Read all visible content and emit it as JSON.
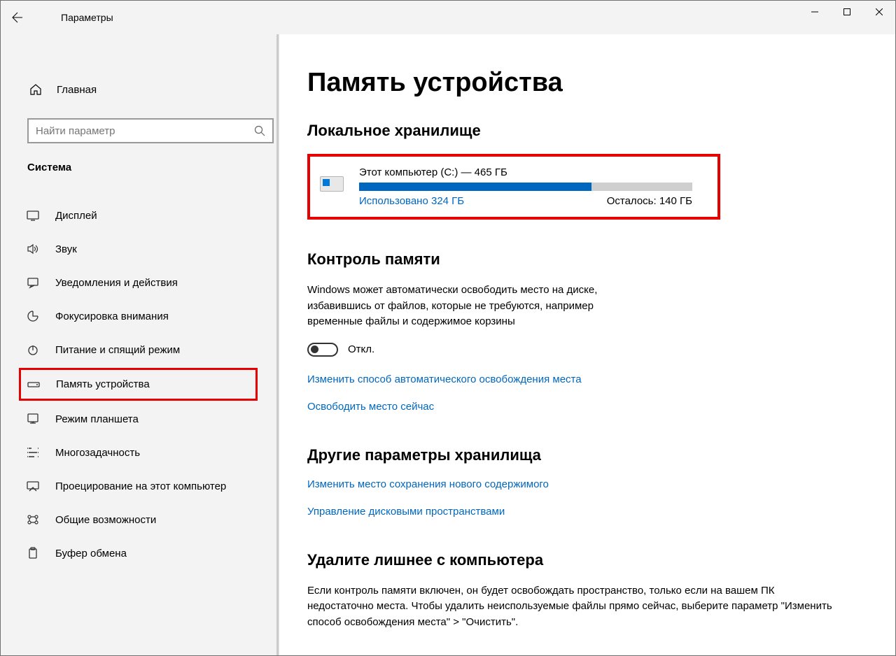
{
  "titlebar": {
    "title": "Параметры"
  },
  "sidebar": {
    "home": "Главная",
    "search_placeholder": "Найти параметр",
    "category": "Система",
    "items": [
      {
        "id": "display",
        "label": "Дисплей"
      },
      {
        "id": "sound",
        "label": "Звук"
      },
      {
        "id": "notifications",
        "label": "Уведомления и действия"
      },
      {
        "id": "focus",
        "label": "Фокусировка внимания"
      },
      {
        "id": "power",
        "label": "Питание и спящий режим"
      },
      {
        "id": "storage",
        "label": "Память устройства"
      },
      {
        "id": "tablet",
        "label": "Режим планшета"
      },
      {
        "id": "multitask",
        "label": "Многозадачность"
      },
      {
        "id": "projecting",
        "label": "Проецирование на этот компьютер"
      },
      {
        "id": "shared",
        "label": "Общие возможности"
      },
      {
        "id": "clipboard",
        "label": "Буфер обмена"
      }
    ]
  },
  "main": {
    "heading": "Память устройства",
    "local_storage_heading": "Локальное хранилище",
    "disk": {
      "title": "Этот компьютер (C:) — 465 ГБ",
      "used_label": "Использовано 324 ГБ",
      "free_label": "Осталось: 140 ГБ",
      "used_percent": 69.7
    },
    "sense_heading": "Контроль памяти",
    "sense_body": "Windows может автоматически освободить место на диске, избавившись от файлов, которые не требуются, например временные файлы и содержимое корзины",
    "toggle_state": "Откл.",
    "link_change_auto": "Изменить способ автоматического освобождения места",
    "link_free_now": "Освободить место сейчас",
    "more_heading": "Другие параметры хранилища",
    "link_change_save": "Изменить место сохранения нового содержимого",
    "link_manage_spaces": "Управление дисковыми пространствами",
    "cleanup_heading": "Удалите лишнее с компьютера",
    "cleanup_body": "Если контроль памяти включен, он будет освобождать пространство, только если на вашем ПК недостаточно места. Чтобы удалить неиспользуемые файлы прямо сейчас, выберите параметр \"Изменить способ освобождения места\" > \"Очистить\"."
  }
}
